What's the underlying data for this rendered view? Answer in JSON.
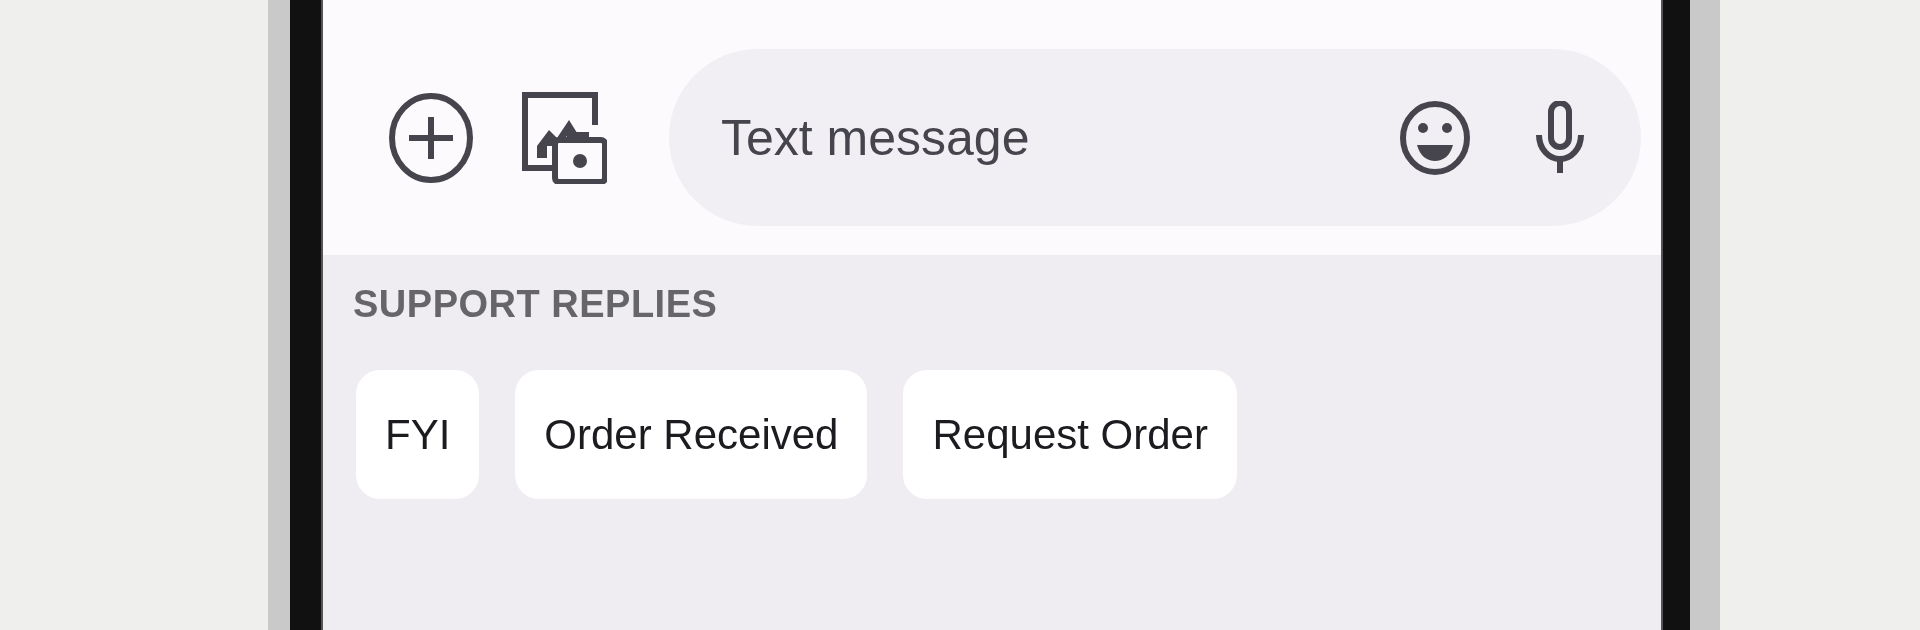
{
  "composer": {
    "placeholder": "Text message"
  },
  "suggestions": {
    "title": "SUPPORT REPLIES",
    "chips": [
      {
        "label": "FYI"
      },
      {
        "label": "Order Received"
      },
      {
        "label": "Request Order"
      }
    ]
  }
}
